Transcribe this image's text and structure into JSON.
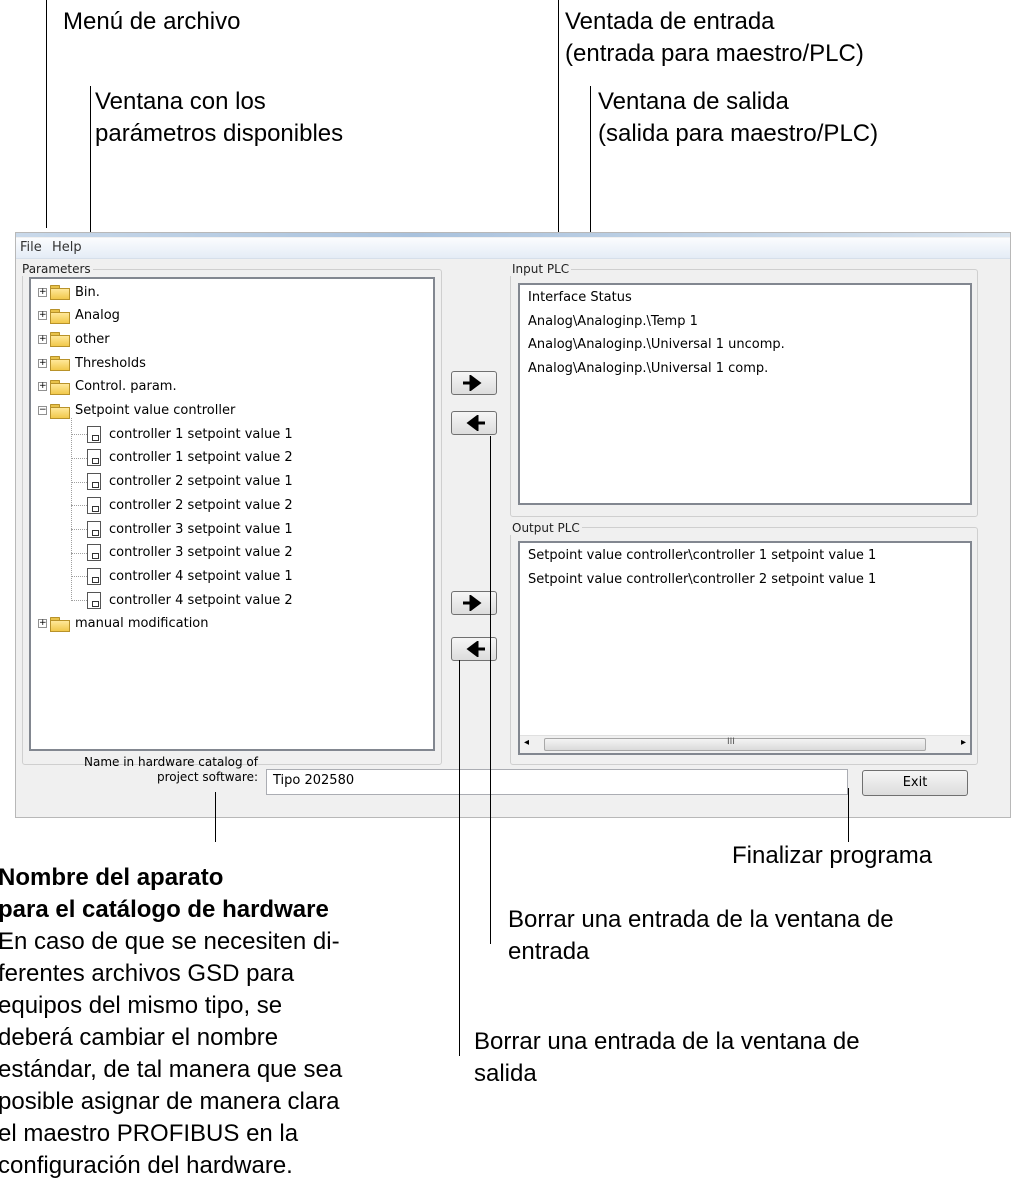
{
  "annotations": {
    "file_menu": "Menú de archivo",
    "params_window": [
      "Ventana con los",
      "parámetros disponibles"
    ],
    "input_window": [
      "Ventada de entrada",
      "(entrada para maestro/PLC)"
    ],
    "output_window": [
      "Ventana de salida",
      "(salida para maestro/PLC)"
    ],
    "device_name_title": [
      "Nombre del aparato",
      "para el catálogo de hardware"
    ],
    "device_name_body": [
      "En caso de que se necesiten di-",
      "ferentes archivos GSD para",
      "equipos del mismo tipo, se",
      "deberá cambiar el nombre",
      "estándar, de tal manera que sea",
      "posible asignar de manera clara",
      "el maestro PROFIBUS en la",
      "configuración del hardware."
    ],
    "exit_program": "Finalizar programa",
    "delete_input": [
      "Borrar una entrada de la ventana de",
      "entrada"
    ],
    "delete_output": [
      "Borrar una entrada de la ventana de",
      "salida"
    ]
  },
  "menu": {
    "file": "File",
    "help": "Help"
  },
  "parameters": {
    "title": "Parameters",
    "tree": [
      {
        "label": "Bin.",
        "type": "folder",
        "state": "collapsed"
      },
      {
        "label": "Analog",
        "type": "folder",
        "state": "collapsed"
      },
      {
        "label": "other",
        "type": "folder",
        "state": "collapsed"
      },
      {
        "label": "Thresholds",
        "type": "folder",
        "state": "collapsed"
      },
      {
        "label": "Control. param.",
        "type": "folder",
        "state": "collapsed"
      },
      {
        "label": "Setpoint value controller",
        "type": "folder",
        "state": "expanded"
      },
      {
        "label": "controller 1 setpoint value 1",
        "type": "item"
      },
      {
        "label": "controller 1 setpoint value 2",
        "type": "item"
      },
      {
        "label": "controller 2 setpoint value 1",
        "type": "item"
      },
      {
        "label": "controller 2 setpoint value 2",
        "type": "item"
      },
      {
        "label": "controller 3 setpoint value 1",
        "type": "item"
      },
      {
        "label": "controller 3 setpoint value 2",
        "type": "item"
      },
      {
        "label": "controller 4 setpoint value 1",
        "type": "item"
      },
      {
        "label": "controller 4 setpoint value 2",
        "type": "item"
      },
      {
        "label": "manual modification",
        "type": "folder",
        "state": "collapsed"
      }
    ]
  },
  "input_plc": {
    "title": "Input PLC",
    "items": [
      "Interface Status",
      "Analog\\Analoginp.\\Temp 1",
      "Analog\\Analoginp.\\Universal 1 uncomp.",
      "Analog\\Analoginp.\\Universal 1 comp."
    ]
  },
  "output_plc": {
    "title": "Output PLC",
    "items": [
      "Setpoint value controller\\controller 1 setpoint value 1",
      "Setpoint value controller\\controller 2 setpoint value 1"
    ]
  },
  "hardware_catalog": {
    "label": [
      "Name in hardware catalog of",
      "project software:"
    ],
    "value": "Tipo 202580"
  },
  "exit_button": "Exit",
  "colors": {
    "accent": "#a9c2dd",
    "list_border": "#828790"
  },
  "icons": [
    "folder-icon",
    "document-icon",
    "arrow-right-icon",
    "arrow-left-icon",
    "scroll-left-icon",
    "scroll-right-icon"
  ]
}
